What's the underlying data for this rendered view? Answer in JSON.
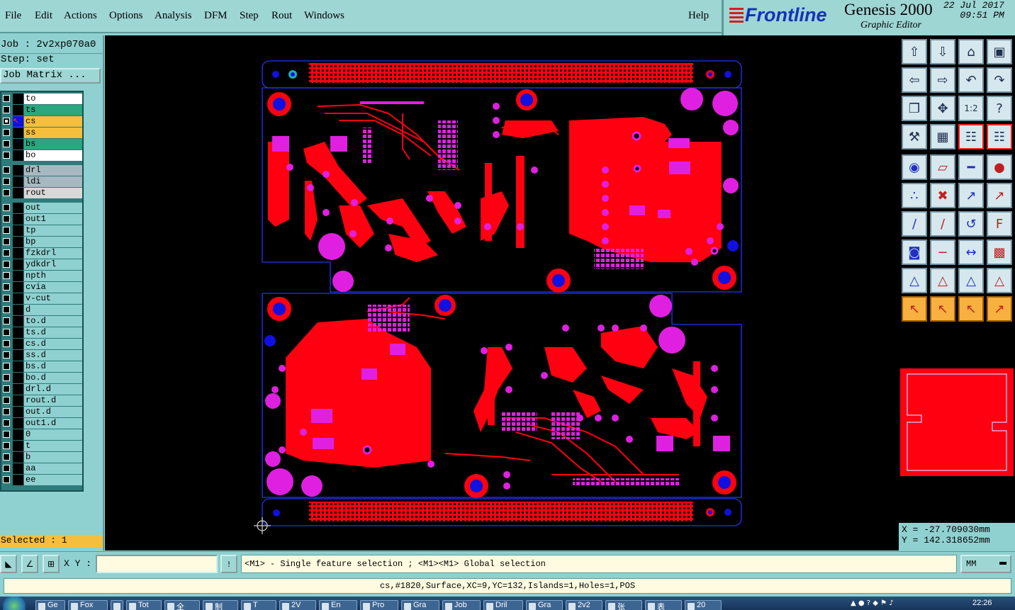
{
  "menu": {
    "file": "File",
    "edit": "Edit",
    "actions": "Actions",
    "options": "Options",
    "analysis": "Analysis",
    "dfm": "DFM",
    "step": "Step",
    "rout": "Rout",
    "windows": "Windows",
    "help": "Help"
  },
  "brand": {
    "logo": "Frontline",
    "product": "Genesis 2000",
    "subtitle": "Graphic Editor",
    "date": "22 Jul 2017",
    "time": "09:51 PM"
  },
  "job": {
    "job_line": "Job : 2v2xp070a0",
    "step_line": "Step: set",
    "matrix_button": "Job Matrix ..."
  },
  "layers": [
    {
      "name": "to",
      "color": "#ffffff",
      "active": false
    },
    {
      "name": "ts",
      "color": "#2aa77e",
      "active": false
    },
    {
      "name": "cs",
      "color": "#f5be3c",
      "active": true,
      "work": true
    },
    {
      "name": "ss",
      "color": "#f5be3c",
      "active": false
    },
    {
      "name": "bs",
      "color": "#2aa77e",
      "active": false
    },
    {
      "name": "bo",
      "color": "#ffffff",
      "active": false
    },
    {
      "name": "drl",
      "color": "#a8b8c0",
      "active": false
    },
    {
      "name": "ldi",
      "color": "#a8b8c0",
      "active": false
    },
    {
      "name": "rout",
      "color": "#d8d8d8",
      "active": false
    },
    {
      "name": "out",
      "color": "#8fd1d0",
      "active": false
    },
    {
      "name": "out1",
      "color": "#8fd1d0",
      "active": false
    },
    {
      "name": "tp",
      "color": "#8fd1d0",
      "active": false
    },
    {
      "name": "bp",
      "color": "#8fd1d0",
      "active": false
    },
    {
      "name": "fzkdrl",
      "color": "#8fd1d0",
      "active": false
    },
    {
      "name": "ydkdrl",
      "color": "#8fd1d0",
      "active": false
    },
    {
      "name": "npth",
      "color": "#8fd1d0",
      "active": false
    },
    {
      "name": "cvia",
      "color": "#8fd1d0",
      "active": false
    },
    {
      "name": "v-cut",
      "color": "#8fd1d0",
      "active": false
    },
    {
      "name": "d",
      "color": "#8fd1d0",
      "active": false
    },
    {
      "name": "to.d",
      "color": "#8fd1d0",
      "active": false
    },
    {
      "name": "ts.d",
      "color": "#8fd1d0",
      "active": false
    },
    {
      "name": "cs.d",
      "color": "#8fd1d0",
      "active": false
    },
    {
      "name": "ss.d",
      "color": "#8fd1d0",
      "active": false
    },
    {
      "name": "bs.d",
      "color": "#8fd1d0",
      "active": false
    },
    {
      "name": "bo.d",
      "color": "#8fd1d0",
      "active": false
    },
    {
      "name": "drl.d",
      "color": "#8fd1d0",
      "active": false
    },
    {
      "name": "rout.d",
      "color": "#8fd1d0",
      "active": false
    },
    {
      "name": "out.d",
      "color": "#8fd1d0",
      "active": false
    },
    {
      "name": "out1.d",
      "color": "#8fd1d0",
      "active": false
    },
    {
      "name": "0",
      "color": "#8fd1d0",
      "active": false
    },
    {
      "name": "t",
      "color": "#8fd1d0",
      "active": false
    },
    {
      "name": "b",
      "color": "#8fd1d0",
      "active": false
    },
    {
      "name": "aa",
      "color": "#8fd1d0",
      "active": false
    },
    {
      "name": "ee",
      "color": "#8fd1d0",
      "active": false
    }
  ],
  "selected_text": "Selected : 1",
  "coords": {
    "x": "X = -27.709030mm",
    "y": "Y = 142.318652mm"
  },
  "cmd": {
    "xy_label": "X Y :",
    "xy_value": "",
    "prompt": "<M1> - Single feature selection ; <M1><M1> Global selection",
    "units": "MM"
  },
  "status": "cs,#1820,Surface,XC=9,YC=132,Islands=1,Holes=1,POS",
  "colors": {
    "copper": "#ff0010",
    "pad": "#e020e0",
    "hole": "#1010e0",
    "outline": "#2233ff",
    "canvas": "#000000"
  },
  "taskbar": {
    "items": [
      "Ge",
      "Fox",
      "",
      "Tot",
      "全",
      "制",
      "T",
      "2V",
      "En",
      "Pro",
      "Gra",
      "Job",
      "Dril",
      "Gra",
      "2v2",
      "张",
      "表",
      "20"
    ],
    "clock": "22:26"
  },
  "tools": [
    "open-icon",
    "save-icon",
    "home-icon",
    "zoom-window-icon",
    "move-left-icon",
    "move-right-icon",
    "undo-icon",
    "redo-icon",
    "fit-icon",
    "pan-icon",
    "one-to-one-icon",
    "help-icon",
    "measure-tool-icon",
    "grid-icon",
    "layer-a-icon",
    "layer-b-icon",
    "add-pad-icon",
    "add-surface-icon",
    "ruler-icon",
    "circle-icon",
    "connect-icon",
    "cross-icon",
    "snap-a-icon",
    "snap-b-icon",
    "line-a-icon",
    "line-b-icon",
    "arc-icon",
    "text-icon",
    "pad-net-icon",
    "minus-icon",
    "dimension-icon",
    "copy-icon",
    "tri-a-icon",
    "tri-b-icon",
    "tri-c-icon",
    "tri-d-icon",
    "select-icon",
    "select-b-icon",
    "select-c-icon",
    "select-net-icon"
  ]
}
